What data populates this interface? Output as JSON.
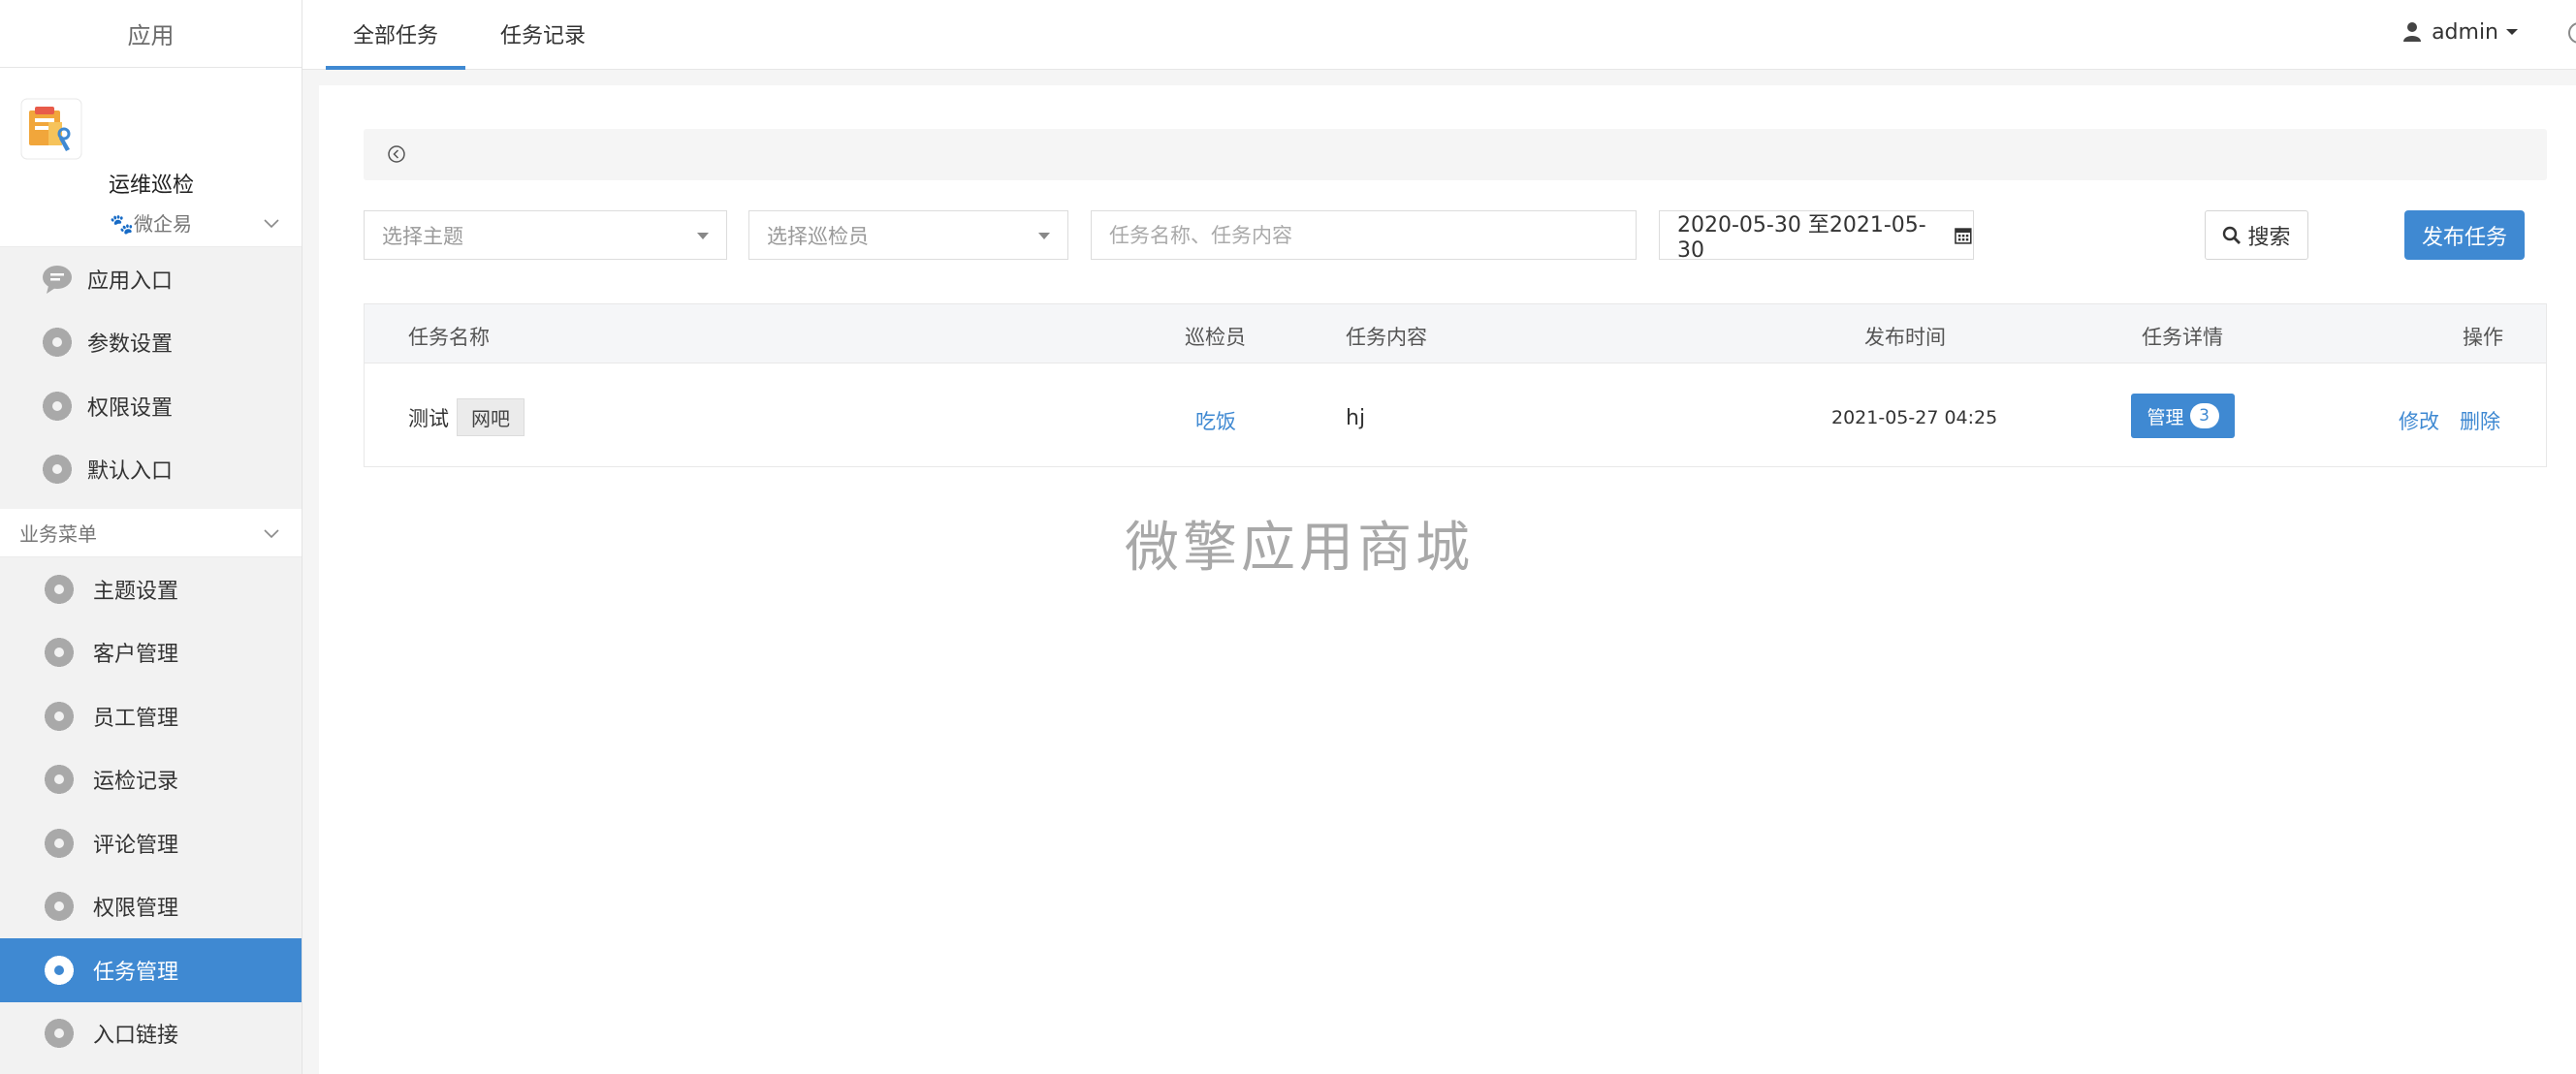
{
  "sidebar": {
    "title": "应用",
    "app": {
      "name": "运维巡检",
      "logo_icon": "clipboard-wrench-icon"
    },
    "group1": {
      "label": "🐾微企易"
    },
    "group1_items": [
      {
        "label": "应用入口",
        "icon": "chat-bubble-icon"
      },
      {
        "label": "参数设置",
        "icon": "gear-icon"
      },
      {
        "label": "权限设置",
        "icon": "gear-icon"
      },
      {
        "label": "默认入口",
        "icon": "gear-icon"
      }
    ],
    "group2": {
      "label": "业务菜单"
    },
    "group2_items": [
      {
        "label": "主题设置",
        "icon": "gear-icon"
      },
      {
        "label": "客户管理",
        "icon": "gear-icon"
      },
      {
        "label": "员工管理",
        "icon": "gear-icon"
      },
      {
        "label": "运检记录",
        "icon": "gear-icon"
      },
      {
        "label": "评论管理",
        "icon": "gear-icon"
      },
      {
        "label": "权限管理",
        "icon": "gear-icon"
      },
      {
        "label": "任务管理",
        "icon": "gear-icon",
        "active": true
      },
      {
        "label": "入口链接",
        "icon": "gear-icon"
      }
    ]
  },
  "topbar": {
    "tabs": [
      {
        "label": "全部任务",
        "active": true
      },
      {
        "label": "任务记录"
      }
    ],
    "user": "admin"
  },
  "filters": {
    "theme_placeholder": "选择主题",
    "inspector_placeholder": "选择巡检员",
    "search_placeholder": "任务名称、任务内容",
    "date_range": "2020-05-30 至2021-05-30",
    "search_label": "搜索",
    "publish_label": "发布任务"
  },
  "table": {
    "headers": {
      "name": "任务名称",
      "inspector": "巡检员",
      "content": "任务内容",
      "time": "发布时间",
      "details": "任务详情",
      "actions": "操作"
    },
    "rows": [
      {
        "name": "测试",
        "tag": "网吧",
        "inspector": "吃饭",
        "content": "hj",
        "time": "2021-05-27 04:25",
        "manage_label": "管理",
        "manage_count": "3",
        "edit_label": "修改",
        "delete_label": "删除"
      }
    ]
  },
  "watermark": "微擎应用商城",
  "colors": {
    "accent": "#3f89d2"
  }
}
